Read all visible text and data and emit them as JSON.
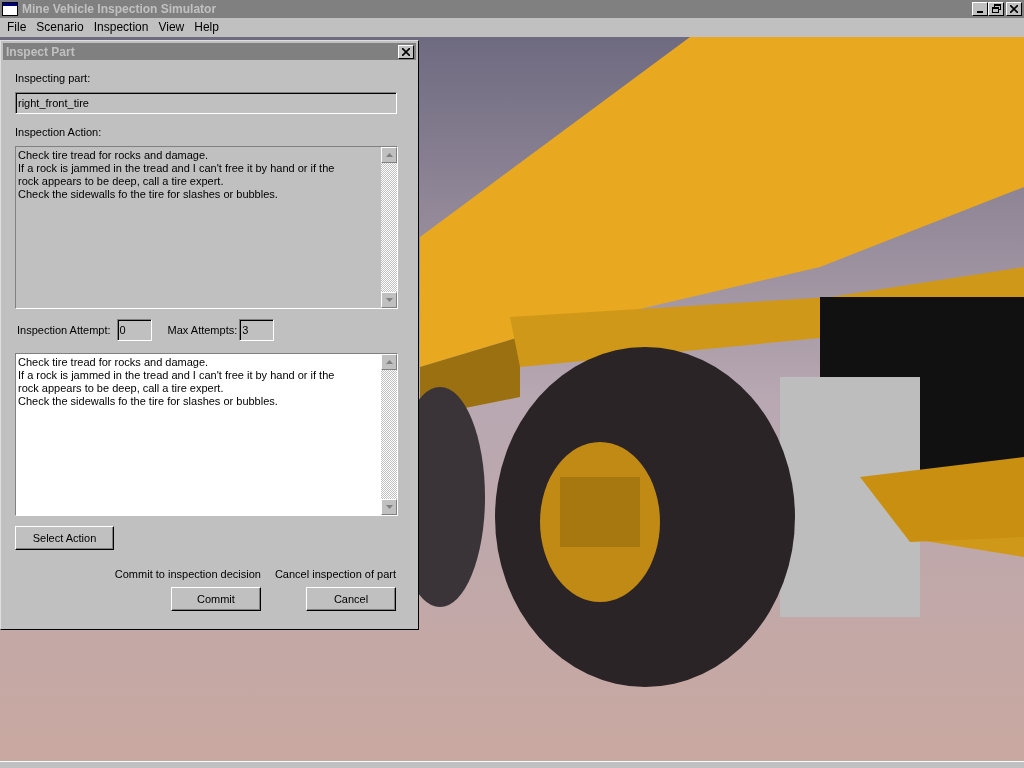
{
  "window": {
    "title": "Mine Vehicle Inspection Simulator"
  },
  "menu": [
    "File",
    "Scenario",
    "Inspection",
    "View",
    "Help"
  ],
  "dialog": {
    "title": "Inspect Part",
    "part_label": "Inspecting part:",
    "part_value": "right_front_tire",
    "action_label": "Inspection Action:",
    "action_text": "Check tire tread for rocks and damage.\nIf a rock is jammed in the tread and I can't free it by hand or if the\nrock appears to be deep, call a tire expert.\nCheck the sidewalls fo the tire for slashes or bubbles.",
    "attempt_label": "Inspection Attempt:",
    "attempt_value": "0",
    "max_label": "Max Attempts:",
    "max_value": "3",
    "notes_text": "Check tire tread for rocks and damage.\nIf a rock is jammed in the tread and I can't free it by hand or if the\nrock appears to be deep, call a tire expert.\nCheck the sidewalls fo the tire for slashes or bubbles.",
    "select_button": "Select Action",
    "commit_hint": "Commit to inspection decision",
    "cancel_hint": "Cancel inspection of part",
    "commit_button": "Commit",
    "cancel_button": "Cancel"
  }
}
